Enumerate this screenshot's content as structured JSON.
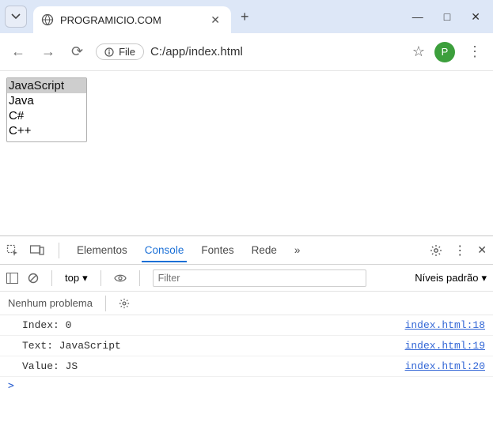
{
  "browser": {
    "tab_title": "PROGRAMICIO.COM",
    "new_tab": "+",
    "win": {
      "min": "—",
      "max": "□",
      "close": "✕"
    }
  },
  "toolbar": {
    "back": "←",
    "forward": "→",
    "reload": "⟳",
    "file_chip_label": "File",
    "url": "C:/app/index.html",
    "star": "☆",
    "avatar_letter": "P",
    "menu": "⋮"
  },
  "page": {
    "options": [
      "JavaScript",
      "Java",
      "C#",
      "C++"
    ],
    "selected_index": 0
  },
  "devtools": {
    "tabs": {
      "elements": "Elementos",
      "console": "Console",
      "sources": "Fontes",
      "network": "Rede",
      "more": "»"
    },
    "toolbar": {
      "context": "top",
      "filter_placeholder": "Filter",
      "levels": "Níveis padrão"
    },
    "issues": "Nenhum problema",
    "logs": [
      {
        "msg": "Index: 0",
        "src": "index.html:18"
      },
      {
        "msg": "Text: JavaScript",
        "src": "index.html:19"
      },
      {
        "msg": "Value: JS",
        "src": "index.html:20"
      }
    ],
    "prompt": ">"
  }
}
